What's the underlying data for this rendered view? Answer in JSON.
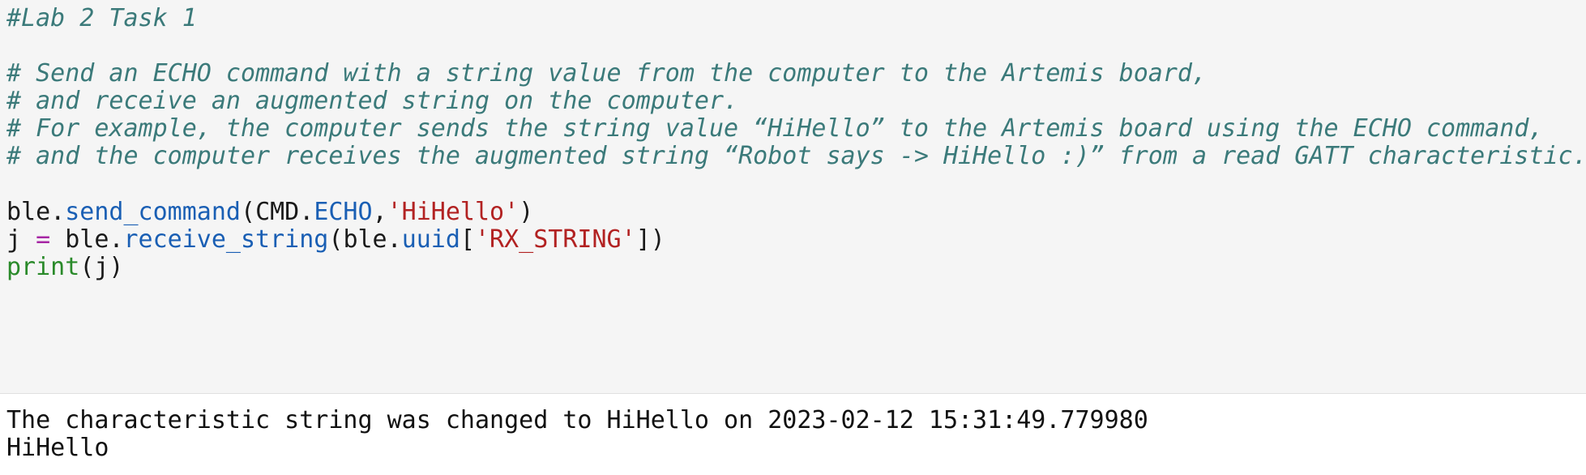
{
  "code": {
    "comments": [
      "#Lab 2 Task 1",
      "# Send an ECHO command with a string value from the computer to the Artemis board,",
      "# and receive an augmented string on the computer.",
      "# For example, the computer sends the string value “HiHello” to the Artemis board using the ECHO command,",
      "# and the computer receives the augmented string “Robot says -> HiHello :)” from a read GATT characteristic."
    ],
    "line1": {
      "obj": "ble",
      "dot": ".",
      "method": "send_command",
      "open": "(",
      "arg_obj": "CMD",
      "arg_dot": ".",
      "arg_attr": "ECHO",
      "comma": ",",
      "arg_str": "'HiHello'",
      "close": ")"
    },
    "line2": {
      "var": "j",
      "eq": "=",
      "obj": "ble",
      "dot": ".",
      "method": "receive_string",
      "open": "(",
      "arg_obj": "ble",
      "arg_dot": ".",
      "arg_attr": "uuid",
      "bracket_open": "[",
      "arg_str": "'RX_STRING'",
      "bracket_close": "])"
    },
    "line3": {
      "builtin": "print",
      "args": "(j)"
    }
  },
  "output": {
    "lines": [
      "The characteristic string was changed to HiHello on 2023-02-12 15:31:49.779980",
      "HiHello"
    ]
  }
}
